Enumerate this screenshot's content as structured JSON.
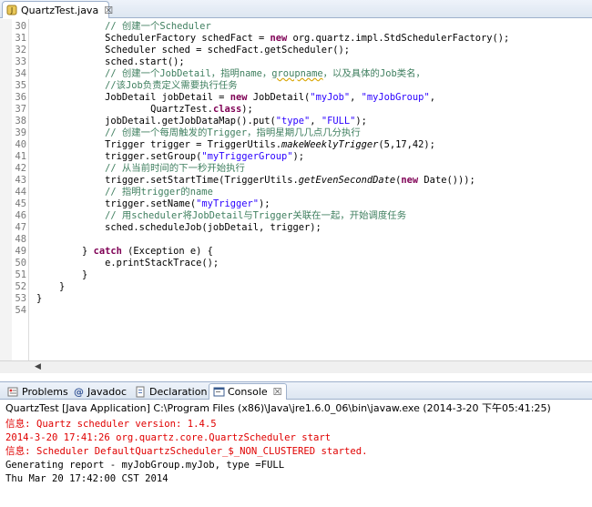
{
  "editor": {
    "tab": {
      "title": "QuartzTest.java",
      "close": "☒"
    },
    "lines": [
      {
        "no": "30",
        "segs": [
          [
            "cm",
            "            // 创建一个Scheduler"
          ]
        ]
      },
      {
        "no": "31",
        "segs": [
          [
            "pl",
            "            SchedulerFactory schedFact = "
          ],
          [
            "kw",
            "new"
          ],
          [
            "pl",
            " org.quartz.impl.StdSchedulerFactory();"
          ]
        ]
      },
      {
        "no": "32",
        "segs": [
          [
            "pl",
            "            Scheduler sched = schedFact.getScheduler();"
          ]
        ]
      },
      {
        "no": "33",
        "segs": [
          [
            "pl",
            "            sched.start();"
          ]
        ]
      },
      {
        "no": "34",
        "segs": [
          [
            "cm",
            "            // 创建一个JobDetail，指明name，"
          ],
          [
            "cmsq",
            "groupname"
          ],
          [
            "cm",
            "，以及具体的Job类名，"
          ]
        ]
      },
      {
        "no": "35",
        "segs": [
          [
            "cm",
            "            //该Job负责定义需要执行任务"
          ]
        ]
      },
      {
        "no": "36",
        "segs": [
          [
            "pl",
            "            JobDetail jobDetail = "
          ],
          [
            "kw",
            "new"
          ],
          [
            "pl",
            " JobDetail("
          ],
          [
            "str",
            "\"myJob\""
          ],
          [
            "pl",
            ", "
          ],
          [
            "str",
            "\"myJobGroup\""
          ],
          [
            "pl",
            ","
          ]
        ]
      },
      {
        "no": "37",
        "segs": [
          [
            "pl",
            "                    QuartzTest."
          ],
          [
            "kw",
            "class"
          ],
          [
            "pl",
            ");"
          ]
        ]
      },
      {
        "no": "38",
        "segs": [
          [
            "pl",
            "            jobDetail.getJobDataMap().put("
          ],
          [
            "str",
            "\"type\""
          ],
          [
            "pl",
            ", "
          ],
          [
            "str",
            "\"FULL\""
          ],
          [
            "pl",
            ");"
          ]
        ]
      },
      {
        "no": "39",
        "segs": [
          [
            "cm",
            "            // 创建一个每周触发的Trigger，指明星期几几点几分执行"
          ]
        ]
      },
      {
        "no": "40",
        "segs": [
          [
            "pl",
            "            Trigger trigger = TriggerUtils."
          ],
          [
            "it",
            "makeWeeklyTrigger"
          ],
          [
            "pl",
            "(5,17,42);"
          ]
        ]
      },
      {
        "no": "41",
        "segs": [
          [
            "pl",
            "            trigger.setGroup("
          ],
          [
            "str",
            "\"myTriggerGroup\""
          ],
          [
            "pl",
            ");"
          ]
        ]
      },
      {
        "no": "42",
        "segs": [
          [
            "cm",
            "            // 从当前时间的下一秒开始执行"
          ]
        ]
      },
      {
        "no": "43",
        "segs": [
          [
            "pl",
            "            trigger.setStartTime(TriggerUtils."
          ],
          [
            "it",
            "getEvenSecondDate"
          ],
          [
            "pl",
            "("
          ],
          [
            "kw",
            "new"
          ],
          [
            "pl",
            " Date()));"
          ]
        ]
      },
      {
        "no": "44",
        "segs": [
          [
            "cm",
            "            // 指明trigger的name"
          ]
        ]
      },
      {
        "no": "45",
        "segs": [
          [
            "pl",
            "            trigger.setName("
          ],
          [
            "str",
            "\"myTrigger\""
          ],
          [
            "pl",
            ");"
          ]
        ]
      },
      {
        "no": "46",
        "segs": [
          [
            "cm",
            "            // 用scheduler将JobDetail与Trigger关联在一起，开始调度任务"
          ]
        ]
      },
      {
        "no": "47",
        "segs": [
          [
            "pl",
            "            sched.scheduleJob(jobDetail, trigger);"
          ]
        ]
      },
      {
        "no": "48",
        "segs": []
      },
      {
        "no": "49",
        "segs": [
          [
            "pl",
            "        } "
          ],
          [
            "kw",
            "catch"
          ],
          [
            "pl",
            " (Exception e) {"
          ]
        ]
      },
      {
        "no": "50",
        "segs": [
          [
            "pl",
            "            e.printStackTrace();"
          ]
        ]
      },
      {
        "no": "51",
        "segs": [
          [
            "pl",
            "        }"
          ]
        ]
      },
      {
        "no": "52",
        "segs": [
          [
            "pl",
            "    }"
          ]
        ]
      },
      {
        "no": "53",
        "segs": [
          [
            "pl",
            "}"
          ]
        ]
      },
      {
        "no": "54",
        "segs": []
      }
    ]
  },
  "views": {
    "tabs": [
      {
        "label": "Problems",
        "icon": "problems-icon",
        "active": false
      },
      {
        "label": "Javadoc",
        "icon": "javadoc-icon",
        "active": false
      },
      {
        "label": "Declaration",
        "icon": "declaration-icon",
        "active": false
      },
      {
        "label": "Console",
        "icon": "console-icon",
        "active": true,
        "close": "☒"
      }
    ]
  },
  "console": {
    "header": "QuartzTest [Java Application] C:\\Program Files (x86)\\Java\\jre1.6.0_06\\bin\\javaw.exe (2014-3-20 下午05:41:25)",
    "lines": [
      {
        "kind": "err",
        "text": "信息: Quartz scheduler version: 1.4.5"
      },
      {
        "kind": "err",
        "text": "2014-3-20 17:41:26 org.quartz.core.QuartzScheduler start"
      },
      {
        "kind": "err",
        "text": "信息: Scheduler DefaultQuartzScheduler_$_NON_CLUSTERED started."
      },
      {
        "kind": "out",
        "text": "Generating report - myJobGroup.myJob, type =FULL"
      },
      {
        "kind": "out",
        "text": "Thu Mar 20 17:42:00 CST 2014"
      }
    ]
  },
  "colors": {
    "keyword": "#7f0055",
    "string": "#2a00ff",
    "comment": "#3f7f5f",
    "console_error": "#e00000"
  }
}
